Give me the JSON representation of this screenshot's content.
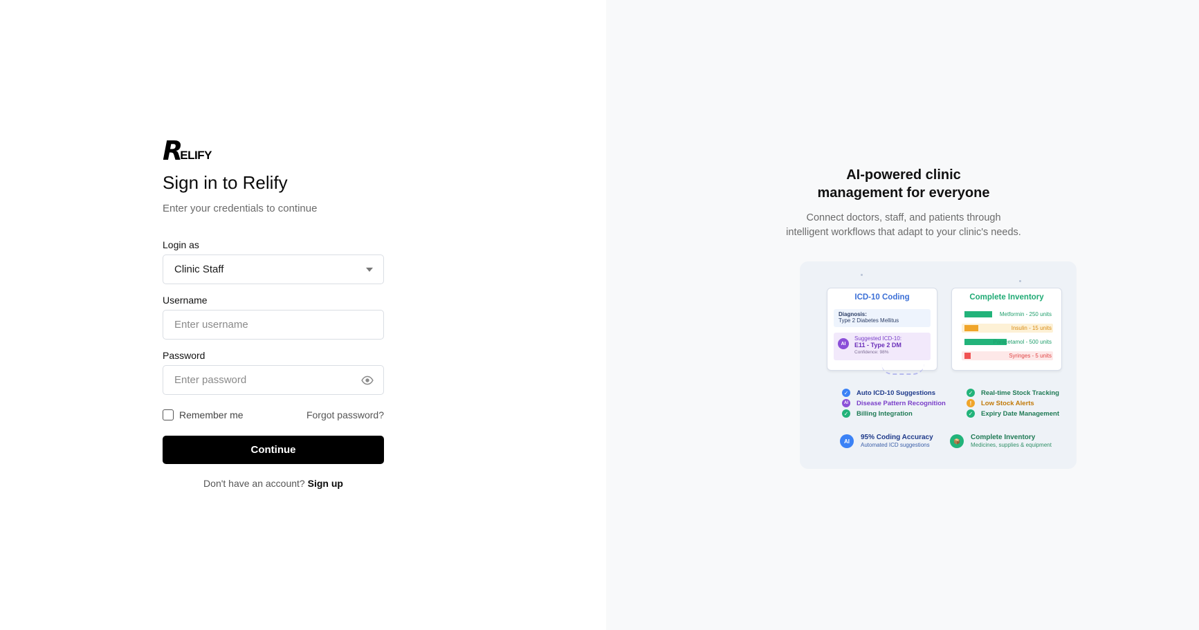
{
  "brand": {
    "logo_initial": "R",
    "logo_rest": "ELIFY"
  },
  "login": {
    "title": "Sign in to Relify",
    "subtitle": "Enter your credentials to continue",
    "login_as_label": "Login as",
    "login_as_value": "Clinic Staff",
    "username_label": "Username",
    "username_placeholder": "Enter username",
    "password_label": "Password",
    "password_placeholder": "Enter password",
    "remember_label": "Remember me",
    "forgot_label": "Forgot password?",
    "continue_label": "Continue",
    "signup_prompt": "Don't have an account?",
    "signup_link": "Sign up"
  },
  "promo": {
    "title": "AI-powered clinic management for everyone",
    "subtitle": "Connect doctors, staff, and patients through intelligent workflows that adapt to your clinic's needs."
  },
  "illustration": {
    "icd_card": {
      "title": "ICD-10 Coding",
      "diagnosis_label": "Diagnosis:",
      "diagnosis_value": "Type 2 Diabetes Mellitus",
      "ai_badge": "AI",
      "suggested_label": "Suggested ICD-10:",
      "suggested_code": "E11 - Type 2 DM",
      "confidence": "Confidence: 98%"
    },
    "inventory_card": {
      "title": "Complete Inventory",
      "items": [
        {
          "label": "Metformin - 250 units",
          "level": 0.3,
          "color": "#22b37a",
          "bg": "#ffffff",
          "text_color": "#1f9e6b"
        },
        {
          "label": "Insulin - 15 units",
          "level": 0.15,
          "color": "#f0a52a",
          "bg": "#fdf1d6",
          "text_color": "#d98b12"
        },
        {
          "label": "Paracetamol - 500 units",
          "level": 0.46,
          "color": "#22b37a",
          "bg": "#ffffff",
          "text_color": "#1f9e6b"
        },
        {
          "label": "Syringes - 5 units",
          "level": 0.07,
          "color": "#f05252",
          "bg": "#fde8e8",
          "text_color": "#e04444"
        }
      ]
    },
    "features_left": [
      {
        "label": "Auto ICD-10 Suggestions",
        "icon": "check-icon",
        "glyph": "✓",
        "color": "#3b82f6",
        "text_color": "#1e3a8a"
      },
      {
        "label": "Disease Pattern Recognition",
        "icon": "ai-icon",
        "glyph": "AI",
        "color": "#8b4fd8",
        "text_color": "#7a3fc9"
      },
      {
        "label": "Billing Integration",
        "icon": "check-icon",
        "glyph": "✓",
        "color": "#22b37a",
        "text_color": "#1f7a55"
      }
    ],
    "features_right": [
      {
        "label": "Real-time Stock Tracking",
        "icon": "check-icon",
        "glyph": "✓",
        "color": "#22b37a",
        "text_color": "#1f7a55"
      },
      {
        "label": "Low Stock Alerts",
        "icon": "alert-icon",
        "glyph": "!",
        "color": "#f0a52a",
        "text_color": "#c27a0a"
      },
      {
        "label": "Expiry Date Management",
        "icon": "check-icon",
        "glyph": "✓",
        "color": "#22b37a",
        "text_color": "#1f7a55"
      }
    ],
    "stats": [
      {
        "icon": "ai-icon",
        "glyph": "AI",
        "color": "#3b82f6",
        "title": "95% Coding Accuracy",
        "subtitle": "Automated ICD suggestions",
        "title_color": "#1e3a8a",
        "sub_color": "#3b5fa8"
      },
      {
        "icon": "box-icon",
        "glyph": "📦",
        "color": "#22b37a",
        "title": "Complete Inventory",
        "subtitle": "Medicines, supplies & equipment",
        "title_color": "#1f7a55",
        "sub_color": "#2f8f66"
      }
    ]
  },
  "colors": {
    "primary_button": "#000000",
    "right_panel_bg": "#f8f9fa",
    "icd_title": "#3b6fd6",
    "inventory_title": "#1faa74"
  }
}
